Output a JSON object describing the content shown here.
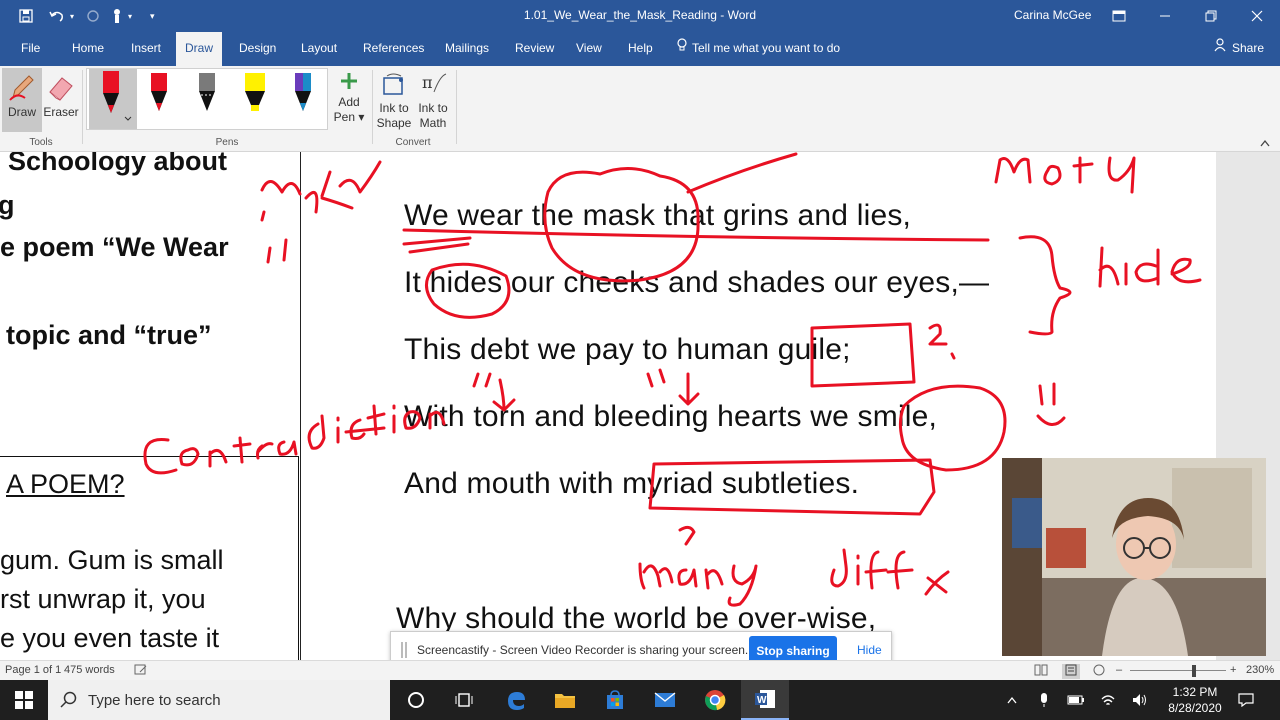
{
  "window": {
    "doc_title": "1.01_We_Wear_the_Mask_Reading  -  Word",
    "user_name": "Carina McGee"
  },
  "tabs": [
    "File",
    "Home",
    "Insert",
    "Draw",
    "Design",
    "Layout",
    "References",
    "Mailings",
    "Review",
    "View",
    "Help"
  ],
  "active_tab": "Draw",
  "tell_me": "Tell me what you want to do",
  "share_label": "Share",
  "ribbon": {
    "draw_label": "Draw",
    "eraser_label": "Eraser",
    "tools_group": "Tools",
    "pens_group": "Pens",
    "add_pen_label_1": "Add",
    "add_pen_label_2": "Pen",
    "ink_shape_1": "Ink to",
    "ink_shape_2": "Shape",
    "ink_math_1": "Ink to",
    "ink_math_2": "Math",
    "convert_group": "Convert",
    "pen_colors": [
      "#e81123",
      "#e81123",
      "#7a7a7a",
      "#fff100",
      "#1c8cc8"
    ]
  },
  "document": {
    "left_lines": [
      "Schoology about",
      "g",
      "e poem “We Wear",
      "topic and “true”"
    ],
    "left_box_heading": "A POEM?",
    "left_box_lines": [
      "gum. Gum is small",
      "rst unwrap it, you",
      "e you even taste it"
    ],
    "poem_lines": [
      "We wear the mask that grins and lies,",
      "It hides our cheeks and shades our eyes,—",
      "This debt we pay to human guile;",
      "With torn and bleeding hearts we smile,",
      "And mouth with myriad subtleties.",
      "Why should the world be over-wise,"
    ],
    "ink_color": "#e81123"
  },
  "screencastify": {
    "message": "Screencastify - Screen Video Recorder is sharing your screen.",
    "stop_label": "Stop sharing",
    "hide_label": "Hide"
  },
  "status": {
    "page": "Page 1 of 1",
    "words": "475 words",
    "zoom": "230%"
  },
  "taskbar": {
    "search_placeholder": "Type here to search",
    "time": "1:32 PM",
    "date": "8/28/2020"
  }
}
